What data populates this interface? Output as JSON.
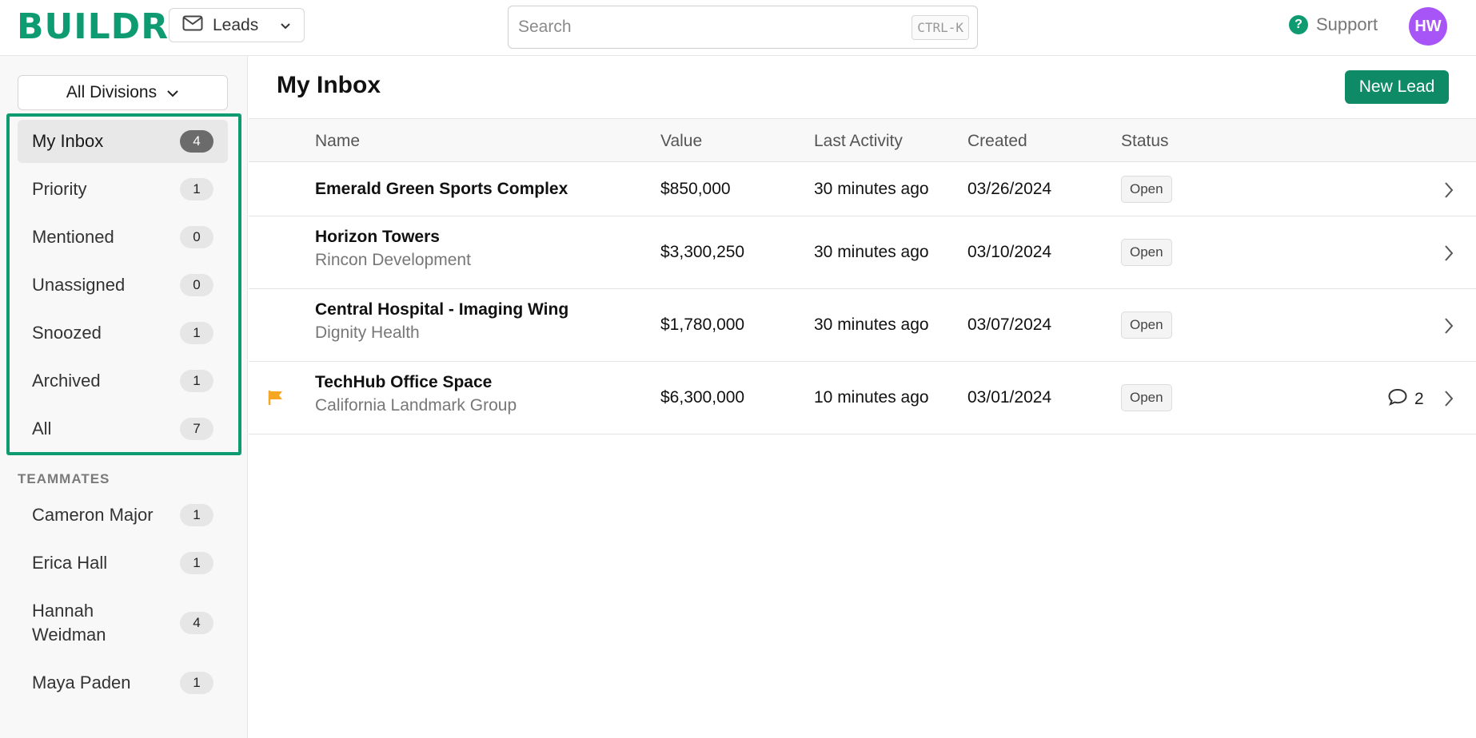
{
  "app": {
    "logo": "BUILDR"
  },
  "topbar": {
    "product_switch_label": "Leads",
    "search_placeholder": "Search",
    "search_shortcut": "CTRL-K",
    "support_label": "Support",
    "avatar_initials": "HW"
  },
  "sidebar": {
    "divisions_label": "All Divisions",
    "inbox_items": [
      {
        "label": "My Inbox",
        "count": "4",
        "active": true
      },
      {
        "label": "Priority",
        "count": "1"
      },
      {
        "label": "Mentioned",
        "count": "0"
      },
      {
        "label": "Unassigned",
        "count": "0"
      },
      {
        "label": "Snoozed",
        "count": "1"
      },
      {
        "label": "Archived",
        "count": "1"
      },
      {
        "label": "All",
        "count": "7"
      }
    ],
    "teammates_title": "TEAMMATES",
    "teammates": [
      {
        "label": "Cameron Major",
        "count": "1"
      },
      {
        "label": "Erica Hall",
        "count": "1"
      },
      {
        "label": "Hannah",
        "label_line2": "Weidman",
        "count": "4"
      },
      {
        "label": "Maya Paden",
        "count": "1"
      }
    ]
  },
  "main": {
    "title": "My Inbox",
    "new_lead_label": "New Lead",
    "columns": {
      "name": "Name",
      "value": "Value",
      "last_activity": "Last Activity",
      "created": "Created",
      "status": "Status"
    },
    "rows": [
      {
        "name": "Emerald Green Sports Complex",
        "company": "",
        "value": "$850,000",
        "last_activity": "30 minutes ago",
        "created": "03/26/2024",
        "status": "Open"
      },
      {
        "name": "Horizon Towers",
        "company": "Rincon Development",
        "value": "$3,300,250",
        "last_activity": "30 minutes ago",
        "created": "03/10/2024",
        "status": "Open"
      },
      {
        "name": "Central Hospital - Imaging Wing",
        "company": "Dignity Health",
        "value": "$1,780,000",
        "last_activity": "30 minutes ago",
        "created": "03/07/2024",
        "status": "Open"
      },
      {
        "name": "TechHub Office Space",
        "company": "California Landmark Group",
        "value": "$6,300,000",
        "last_activity": "10 minutes ago",
        "created": "03/01/2024",
        "status": "Open",
        "comments": "2",
        "flagged": true
      }
    ]
  },
  "colors": {
    "brand": "#0f9b72",
    "button": "#0f8a66",
    "avatar": "#a855f7",
    "flag": "#f5a623"
  },
  "icons": {
    "product_switch": "envelope-icon",
    "support": "help-circle-icon",
    "row_open": "chevron-right-icon",
    "comment": "comment-bubble-icon",
    "priority": "flag-icon"
  }
}
